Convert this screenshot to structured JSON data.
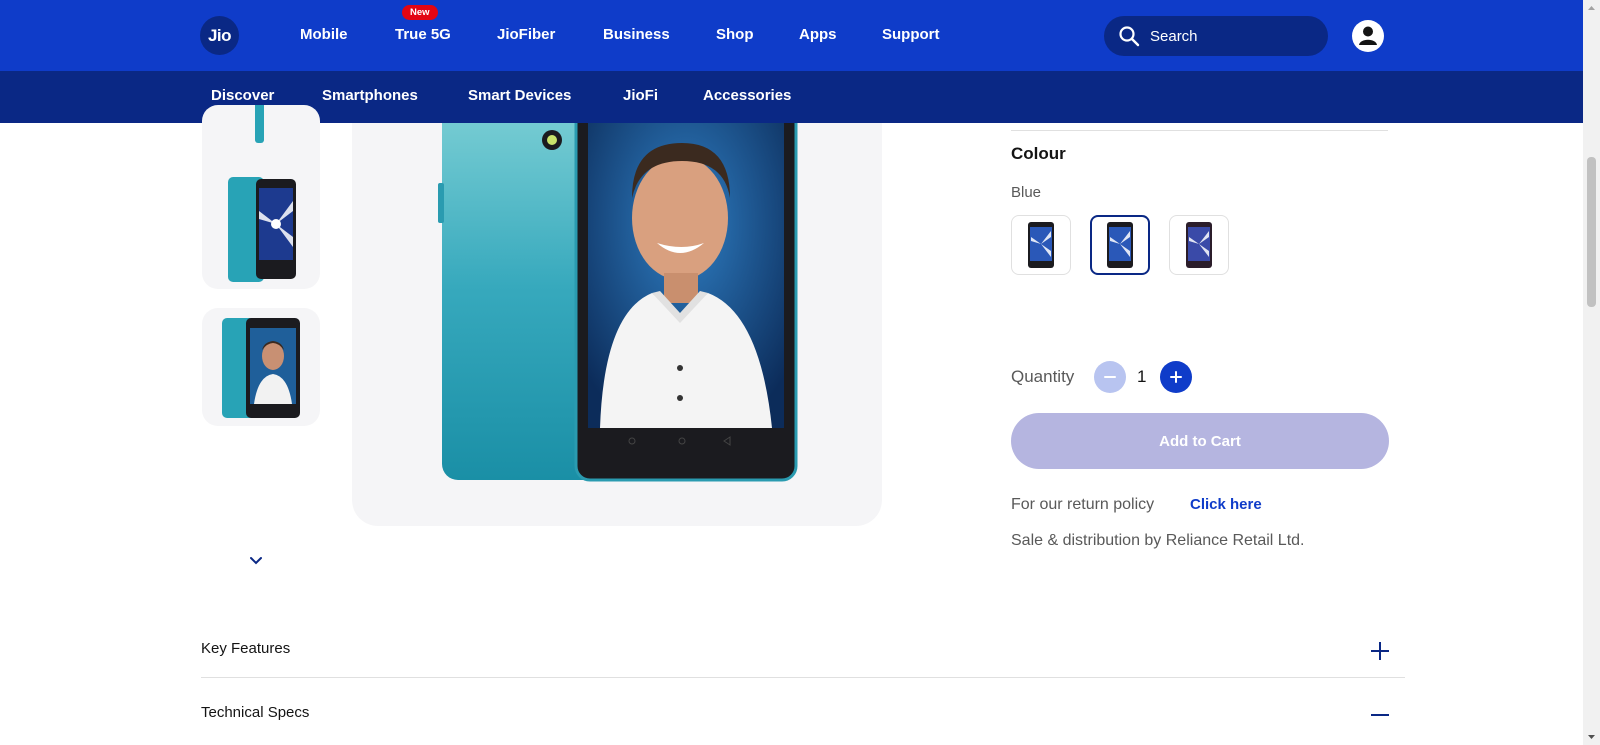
{
  "header": {
    "logo_text": "Jio",
    "nav": [
      {
        "label": "Mobile"
      },
      {
        "label": "True 5G",
        "badge": "New"
      },
      {
        "label": "JioFiber"
      },
      {
        "label": "Business"
      },
      {
        "label": "Shop"
      },
      {
        "label": "Apps"
      },
      {
        "label": "Support"
      }
    ],
    "search_placeholder": "Search",
    "search_icon": "search-icon",
    "profile_icon": "user-icon"
  },
  "subnav": [
    {
      "label": "Discover"
    },
    {
      "label": "Smartphones"
    },
    {
      "label": "Smart Devices"
    },
    {
      "label": "JioFi"
    },
    {
      "label": "Accessories"
    }
  ],
  "product": {
    "colour_title": "Colour",
    "selected_colour": "Blue",
    "quantity_label": "Quantity",
    "quantity_value": "1",
    "add_to_cart": "Add to Cart",
    "return_text": "For our return policy",
    "return_link": "Click here",
    "sale_text": "Sale & distribution by Reliance Retail Ltd."
  },
  "accordion": [
    {
      "title": "Key Features",
      "icon": "plus-icon"
    },
    {
      "title": "Technical Specs",
      "icon": "minus-icon"
    }
  ],
  "colors": {
    "brand_blue": "#0f3cc9",
    "dark_blue": "#0a2885",
    "badge_red": "#e30513",
    "disabled_button": "#b5b5e0",
    "phone_teal": "#28a3b6"
  }
}
